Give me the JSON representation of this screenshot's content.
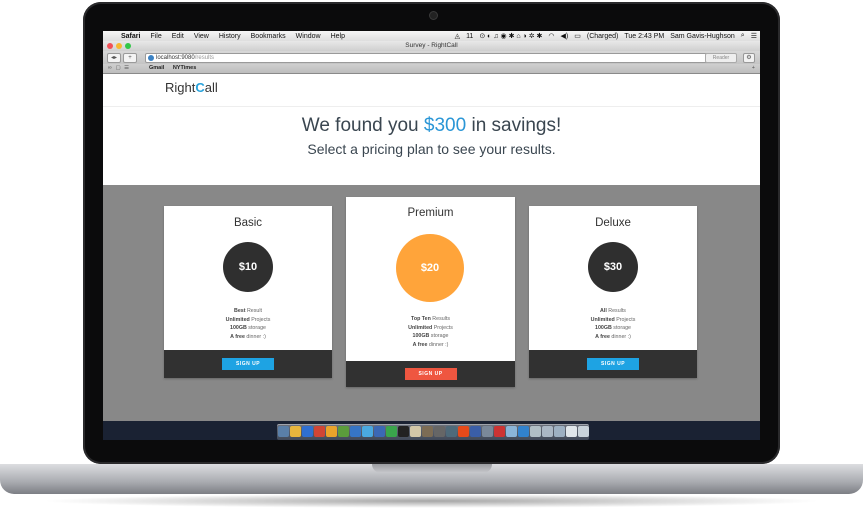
{
  "os": {
    "menubar": {
      "apple": "",
      "app": "Safari",
      "menus": [
        "File",
        "Edit",
        "View",
        "History",
        "Bookmarks",
        "Window",
        "Help"
      ],
      "status": {
        "battery_num": "11",
        "charged": "(Charged)",
        "clock": "Tue 2:43 PM",
        "user": "Sam Gavis-Hughson"
      }
    },
    "dock_icon_colors": [
      "#5a7fa8",
      "#e7b53d",
      "#2f6fd1",
      "#d04535",
      "#eaa32b",
      "#5b9c3c",
      "#3675c5",
      "#4aa9e0",
      "#3b68b5",
      "#3aa54c",
      "#222222",
      "#d2c7a8",
      "#7c6c55",
      "#666666",
      "#4e6a7a",
      "#e64a19",
      "#3a5ea8",
      "#7a8899",
      "#cc3333",
      "#8ab4d8",
      "#3182ce",
      "#b0bec5",
      "#aab7c4",
      "#9db0c2",
      "#e0e6ea",
      "#c9d3da"
    ]
  },
  "browser": {
    "window_title": "Survey - RightCall",
    "url_host": "localhost:9080",
    "url_path": "/results",
    "reader_label": "Reader",
    "bookmarks": [
      "Gmail",
      "NYTimes"
    ]
  },
  "site": {
    "logo_right": "Right",
    "logo_c": "C",
    "logo_all": "all",
    "hero": {
      "prefix": "We found you ",
      "amount": "$300",
      "suffix": " in savings!",
      "subtitle": "Select a pricing plan to see your results."
    },
    "plans": [
      {
        "name": "Basic",
        "price": "$10",
        "color": "#2f2f2f",
        "features": [
          {
            "b": "Best",
            "t": " Result"
          },
          {
            "b": "Unlimited",
            "t": " Projects"
          },
          {
            "b": "100GB",
            "t": " storage"
          },
          {
            "b": "A free",
            "t": " dinner :)"
          }
        ],
        "button": "SIGN UP",
        "button_color": "#1ea3e3"
      },
      {
        "name": "Premium",
        "price": "$20",
        "color": "#ffa43a",
        "features": [
          {
            "b": "Top Ten",
            "t": " Results"
          },
          {
            "b": "Unlimited",
            "t": " Projects"
          },
          {
            "b": "100GB",
            "t": " storage"
          },
          {
            "b": "A free",
            "t": " dinner :)"
          }
        ],
        "button": "SIGN UP",
        "button_color": "#ef5640"
      },
      {
        "name": "Deluxe",
        "price": "$30",
        "color": "#2f2f2f",
        "features": [
          {
            "b": "All",
            "t": " Results"
          },
          {
            "b": "Unlimited",
            "t": " Projects"
          },
          {
            "b": "100GB",
            "t": " storage"
          },
          {
            "b": "A free",
            "t": " dinner :)"
          }
        ],
        "button": "SIGN UP",
        "button_color": "#1ea3e3"
      }
    ]
  }
}
